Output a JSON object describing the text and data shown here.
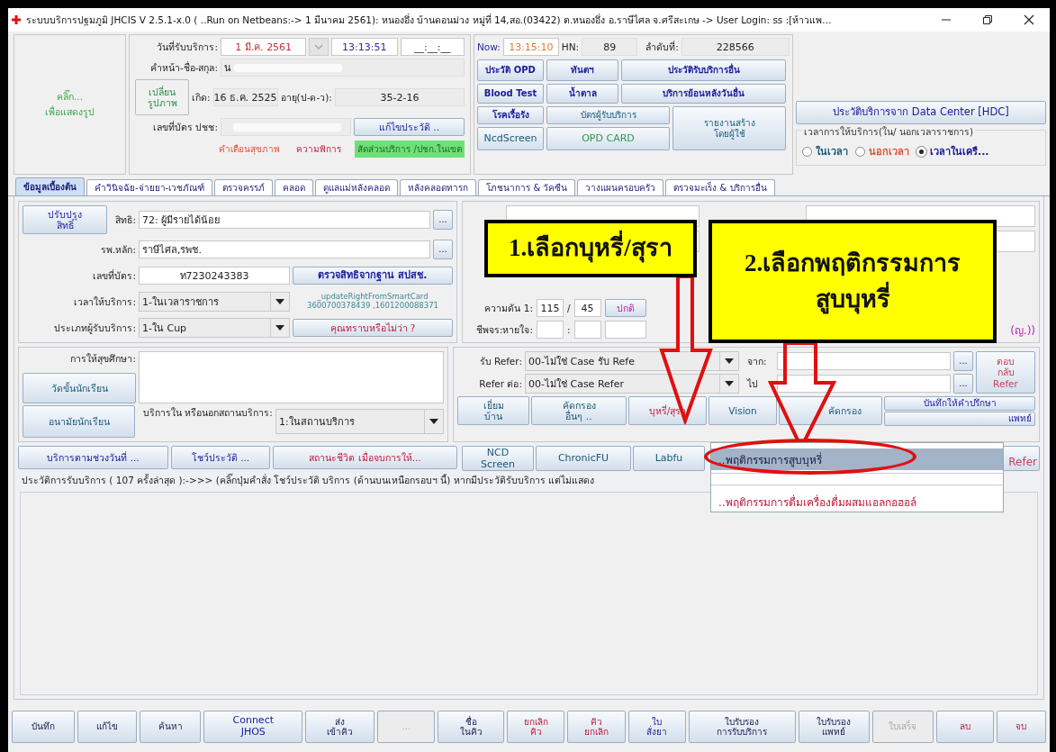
{
  "window": {
    "title": "ระบบบริการปฐมภูมิ JHCIS V 2.5.1-x.0 ( ..Run on Netbeans:-> 1 มีนาคม 2561): หนองอึ่ง บ้านดอนม่วง หมู่ที่ 14,สอ.(03422) ต.หนองอึ่ง อ.ราษีไศล จ.ศรีสะเกษ -> User Login: ss :[ห้าวแพ..."
  },
  "photo": {
    "hint": "คลิ๊ก...\nเพื่อแสดงรูป"
  },
  "patient": {
    "date_label": "วันที่รับบริการ:",
    "date": "1 มี.ค. 2561",
    "time": "13:13:51",
    "end_time": "__:__:__",
    "name_label": "คำหน้า-ชื่อ-สกุล:",
    "name": "น",
    "photo_button": "เปลี่ยน\nรูปภาพ",
    "birth_label": "เกิด:",
    "birth": "16 ธ.ค. 2525",
    "age_label": "อายุ(ป-ด-ว):",
    "age": "35-2-16",
    "id_label": "เลขที่บัตร ปชช:",
    "edit_button": "แก้ไขประวัติ ..",
    "links": [
      {
        "text": "คำเตือนสุขภาพ",
        "kind": "warning"
      },
      {
        "text": "ความพิการ",
        "kind": "danger"
      },
      {
        "text": "สัดส่วนบริการ /ปชก.ในเขต",
        "kind": "highlight"
      }
    ]
  },
  "status": {
    "now_label": "Now:",
    "now": "13:15:10",
    "hn_label": "HN:",
    "hn": "89",
    "seq_label": "ลำดับที่:",
    "seq": "228566"
  },
  "quick_buttons": [
    {
      "label": "ประวัติ OPD",
      "kind": "primary"
    },
    {
      "label": "ทันตฯ",
      "kind": "primary"
    },
    {
      "label": "ประวัติรับบริการอื่น",
      "kind": "primary"
    },
    {
      "label": "Blood Test",
      "kind": "primary"
    },
    {
      "label": "น้ำตาล",
      "kind": "primary"
    },
    {
      "label": "บริการย้อนหลังวันอื่น",
      "kind": "primary"
    },
    {
      "label": "โรคเรื้อรัง",
      "kind": "primary"
    },
    {
      "label": "NcdScreen",
      "kind": "secondary"
    },
    {
      "label": "บัตรผู้รับบริการ",
      "kind": "secondary"
    },
    {
      "label": "OPD CARD",
      "kind": "success"
    },
    {
      "label": "รายงานสร้าง\nโดยผู้ใช้",
      "kind": "secondary"
    }
  ],
  "hdc_button": "ประวัติบริการจาก Data Center [HDC]",
  "service_time": {
    "legend": "เวลาการให้บริการ(ใน/ นอกเวลาราชการ)",
    "options": [
      {
        "label": "ในเวลา",
        "kind": "secondary",
        "selected": false
      },
      {
        "label": "นอกเวลา",
        "kind": "warning",
        "selected": false
      },
      {
        "label": "เวลาในเครื...",
        "kind": "primary",
        "selected": true
      }
    ]
  },
  "tabs": [
    {
      "label": "ข้อมูลเบื้องต้น",
      "selected": true
    },
    {
      "label": "คำวินิจฉัย-จ่ายยา-เวชภัณฑ์",
      "selected": false
    },
    {
      "label": "ตรวจครรภ์",
      "selected": false
    },
    {
      "label": "คลอด",
      "selected": false
    },
    {
      "label": "ดูแลแม่หลังคลอด",
      "selected": false
    },
    {
      "label": "หลังคลอดทารก",
      "selected": false
    },
    {
      "label": "โภชนาการ & วัคซีน",
      "selected": false
    },
    {
      "label": "วางแผนครอบครัว",
      "selected": false
    },
    {
      "label": "ตรวจมะเร็ง & บริการอื่น",
      "selected": false
    }
  ],
  "rights": {
    "update_button": "ปรับปรุง\nสิทธิ์",
    "right_label": "สิทธิ:",
    "right": "72: ผู้มีรายได้น้อย",
    "right_more": "...",
    "hospital_label": "รพ.หลัก:",
    "hospital": "ราษีไศล,รพช.",
    "hospital_more": "...",
    "card_label": "เลขที่บัตร:",
    "card": "ท7230243383",
    "check_button": "ตรวจสิทธิจากฐาน สปสช.",
    "time_label": "เวลาให้บริการ:",
    "time": "1-ในเวลาราชการ",
    "smartcard": "_updateRightFromSmartCard\n3600700378439 ,1601200088371",
    "type_label": "ประเภทผู้รับบริการ:",
    "type": "1-ใน Cup",
    "tip_button": "คุณทราบหรือไม่ว่า ?"
  },
  "vitals": {
    "bp_label": "ความดัน 1:",
    "systolic": "115",
    "slash": "/",
    "diastolic": "45",
    "bp_result": "ปกติ",
    "pulse_label": "ชีพจร:หายใจ:",
    "colon": ":",
    "tail": "(ญ.))"
  },
  "education": {
    "label": "การให้สุขศึกษา:",
    "measure_button": "วัดขั้นนักเรียน",
    "health_button": "อนามัยนักเรียน",
    "place_label": "บริการใน หรือนอกสถานบริการ:",
    "place": "1:ในสถานบริการ"
  },
  "refer": {
    "in_label": "รับ Refer:",
    "in": "00-ไม่ใช่ Case รับ Refe",
    "from_label": "จาก:",
    "from_more": "...",
    "out_label": "Refer ต่อ:",
    "out": "00-ไม่ใช่ Case Refer",
    "to_label": "ไป",
    "to_more": "...",
    "reply_button": "ตอบ\nกลับ\nRefer"
  },
  "service_buttons": [
    {
      "label": "เยี่ยม\nบ้าน",
      "kind": "secondary"
    },
    {
      "label": "คัดกรอง\nอื่นๆ ..",
      "kind": "secondary"
    },
    {
      "label": "บุหรี่/สุรา",
      "kind": "danger"
    },
    {
      "label": "Vision",
      "kind": "secondary"
    },
    {
      "label": "คัดกรอง",
      "kind": "secondary"
    }
  ],
  "counsel_buttons": [
    {
      "label": "บันทึกให้คำปรึกษา"
    },
    {
      "label": "แพทย์"
    }
  ],
  "action_buttons": [
    {
      "label": "บริการตามช่วงวันที่ ...",
      "kind": "primary"
    },
    {
      "label": "โชว์ประวัติ ...",
      "kind": "primary"
    },
    {
      "label": "สถานะชีวิต เมื่อจบการให้...",
      "kind": "danger"
    }
  ],
  "screen_buttons": [
    {
      "label": "NCD\nScreen",
      "kind": "secondary"
    },
    {
      "label": "ChronicFU",
      "kind": "secondary"
    },
    {
      "label": "Labfu",
      "kind": "secondary"
    },
    {
      "label": "Refer",
      "kind": "muted"
    }
  ],
  "history": "ประวัติการรับบริการ ( 107 ครั้งล่าสุด ):->>> (คลิ๊กปุ่มคำสั่ง โชว์ประวัติ บริการ (ด้านบนเหนือกรอบฯ นี้) หากมีประวัติรับบริการ แต่ไม่แสดง",
  "popup_menu": [
    {
      "label": "..พฤติกรรมการสูบบุหรี่",
      "selected": true,
      "kind": "plain"
    },
    {
      "label": "..พฤติกรรมการดื่มเครื่องดื่มผสมแอลกอฮอล์",
      "selected": false,
      "kind": "danger"
    }
  ],
  "callouts": [
    "1.เลือกบุหรี่/สุรา",
    "2.เลือกพฤติกรรมการ\nสูบบุหรี่"
  ],
  "toolbar": [
    {
      "label": "บันทึก",
      "kind": "plain",
      "disabled": false
    },
    {
      "label": "แก้ไข",
      "kind": "plain",
      "disabled": false
    },
    {
      "label": "ค้นหา",
      "kind": "plain",
      "disabled": false
    },
    {
      "label": "Connect\nJHOS",
      "kind": "primary",
      "disabled": false
    },
    {
      "label": "ส่ง\nเข้าคิว",
      "kind": "plain",
      "disabled": false
    },
    {
      "label": "...",
      "kind": "plain",
      "disabled": true
    },
    {
      "label": "ชื่อ\nในคิว",
      "kind": "plain",
      "disabled": false
    },
    {
      "label": "ยกเลิก\nคิว",
      "kind": "danger",
      "disabled": false
    },
    {
      "label": "คิว\nยกเลิก",
      "kind": "danger",
      "disabled": false
    },
    {
      "label": "ใบ\nสั่งยา",
      "kind": "primary",
      "disabled": false
    },
    {
      "label": "ใบรับรอง\nการรับบริการ",
      "kind": "plain",
      "disabled": false
    },
    {
      "label": "ใบรับรอง\nแพทย์",
      "kind": "plain",
      "disabled": false
    },
    {
      "label": "ใบเสร็จ",
      "kind": "plain",
      "disabled": true
    },
    {
      "label": "ลบ",
      "kind": "danger",
      "disabled": false
    },
    {
      "label": "จบ",
      "kind": "danger",
      "disabled": false
    }
  ]
}
